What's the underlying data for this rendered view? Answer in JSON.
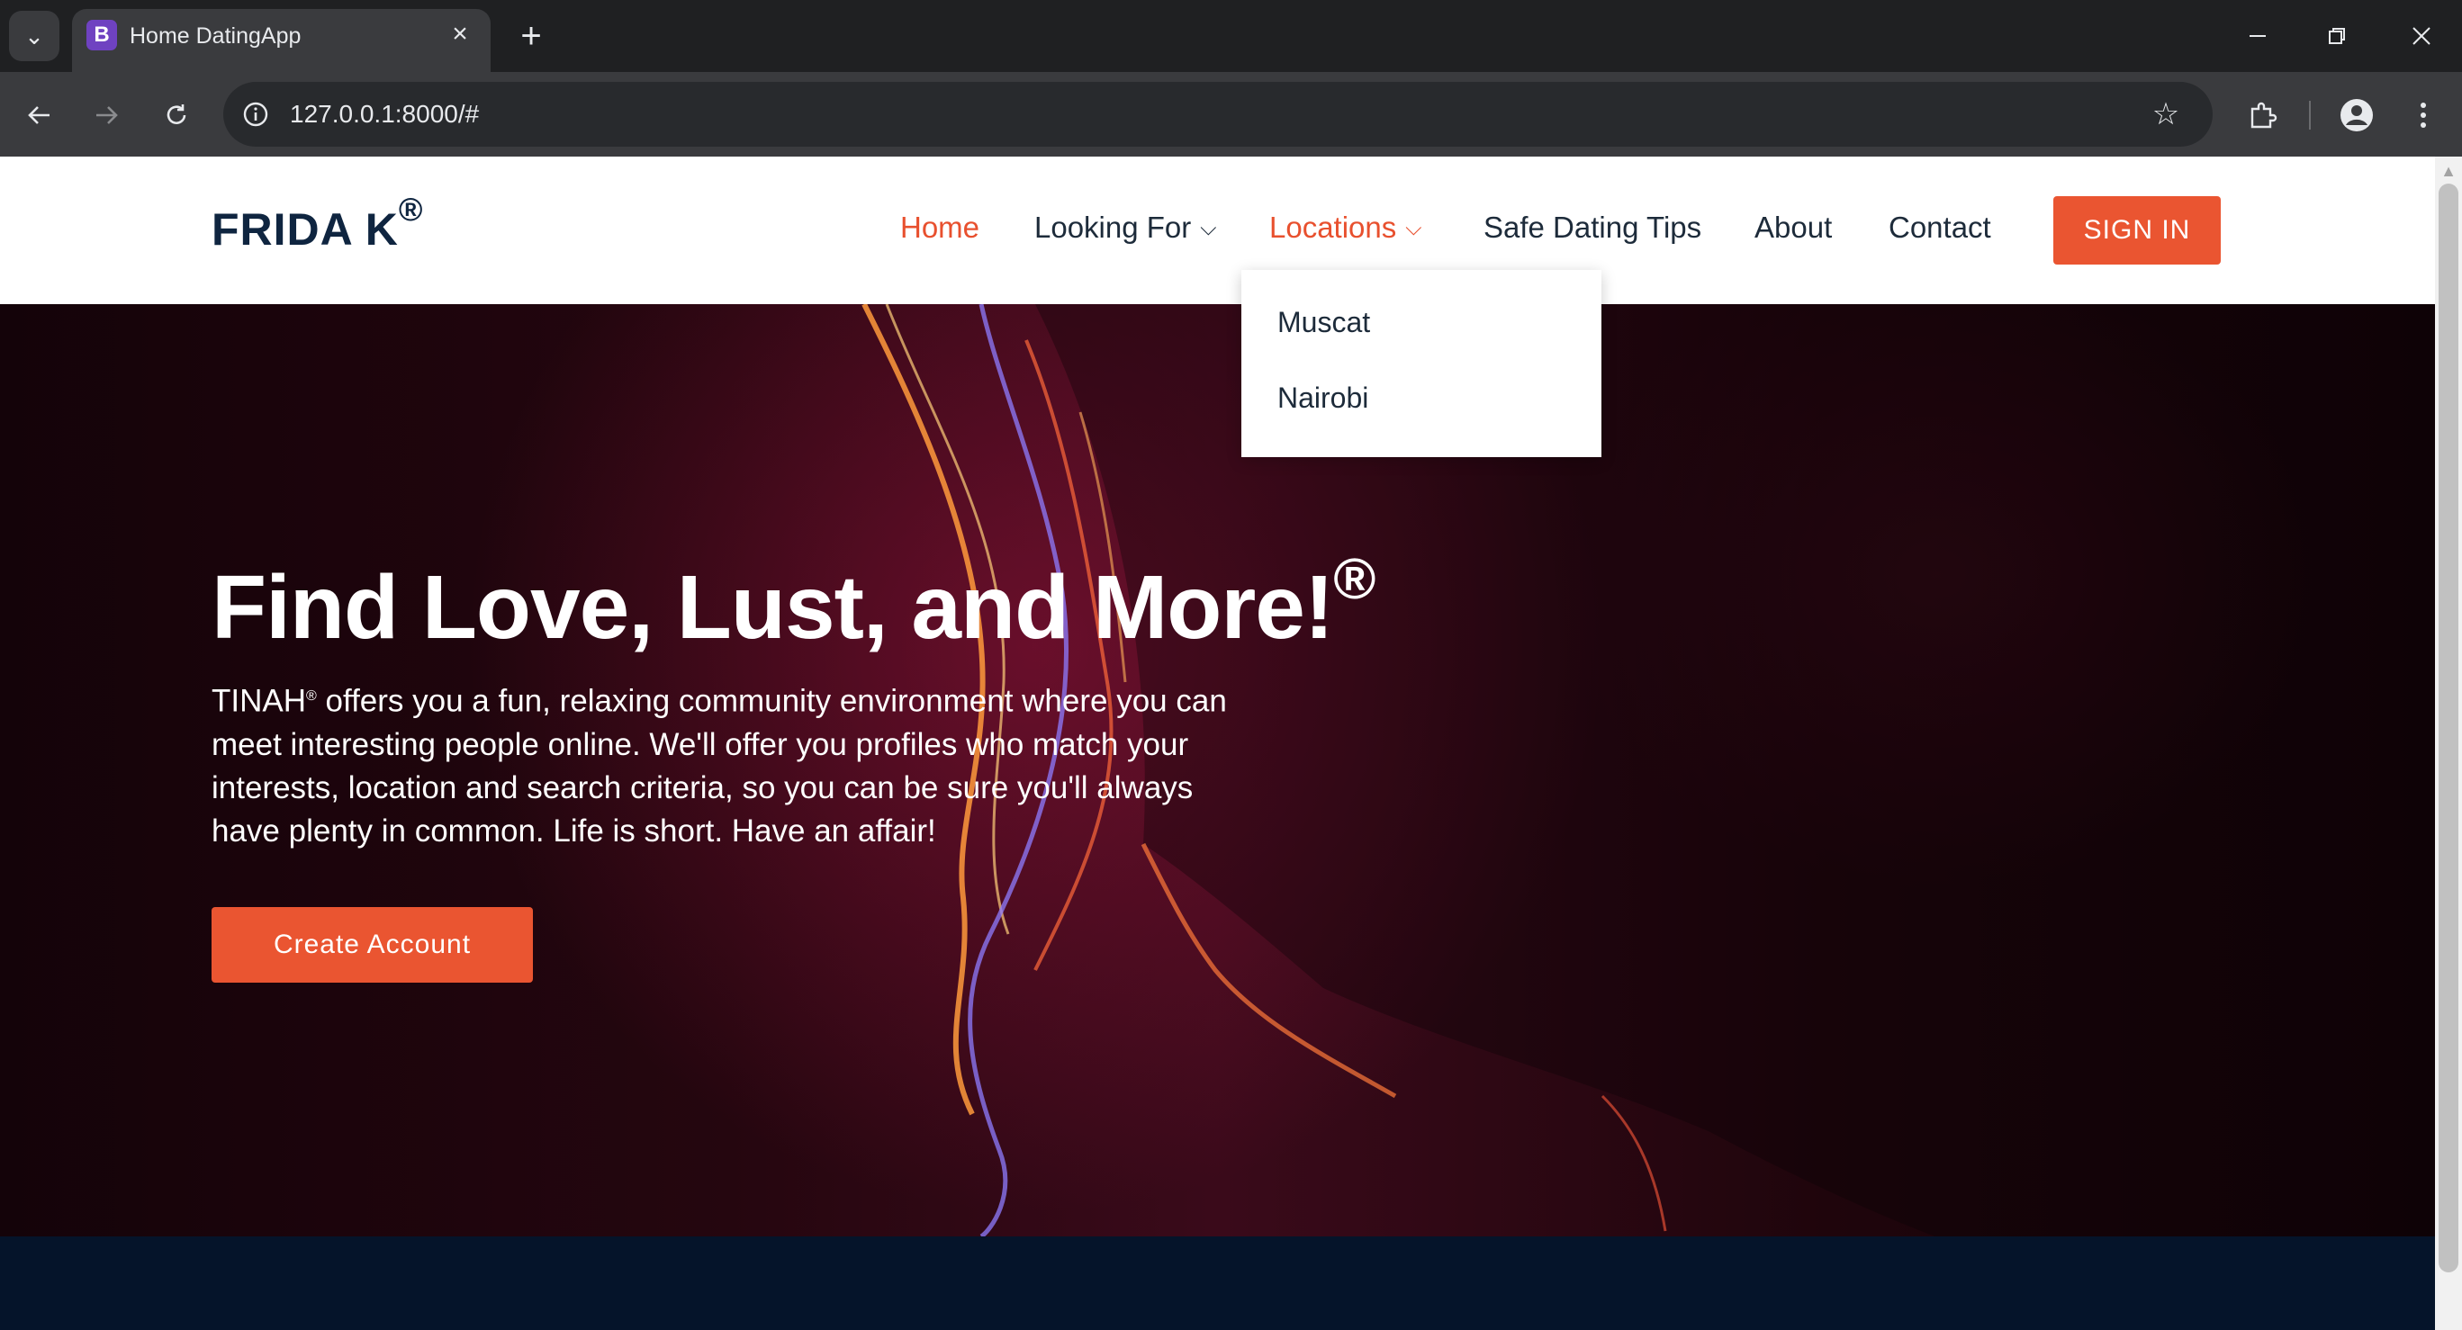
{
  "browser": {
    "tab_title": "Home DatingApp",
    "tab_favicon_letter": "B",
    "url": "127.0.0.1:8000/#",
    "icons": {
      "tab_search": "chevron-down-icon",
      "tab_close": "close-icon",
      "new_tab": "plus-icon",
      "back": "back-arrow-icon",
      "forward": "forward-arrow-icon",
      "reload": "reload-icon",
      "site_info": "info-icon",
      "bookmark": "star-icon",
      "extensions": "puzzle-icon",
      "profile": "profile-icon",
      "menu": "kebab-menu-icon"
    }
  },
  "site": {
    "brand": "FRIDA K",
    "brand_mark": "®",
    "nav": {
      "home": "Home",
      "looking_for": "Looking For",
      "locations": "Locations",
      "safe_dating": "Safe Dating Tips",
      "about": "About",
      "contact": "Contact"
    },
    "signin": "SIGN IN",
    "locations_dropdown": [
      "Muscat",
      "Nairobi"
    ],
    "hero": {
      "title": "Find Love, Lust, and More!",
      "title_mark": "®",
      "text_brand": "TINAH",
      "text_brand_mark": "®",
      "text_body": " offers you a fun, relaxing community environment where you can meet interesting people online. We'll offer you profiles who match your interests, location and search criteria, so you can be sure you'll always have plenty in common. Life is short. Have an affair!",
      "cta": "Create Account"
    }
  },
  "colors": {
    "accent": "#ea5531",
    "brand_navy": "#0f2540",
    "footer_band": "#05142a"
  }
}
